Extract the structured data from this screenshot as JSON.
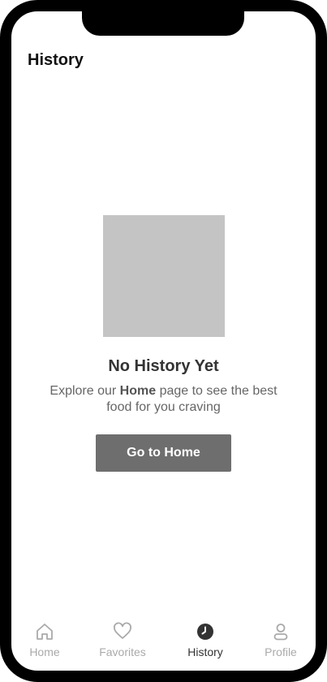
{
  "header": {
    "title": "History"
  },
  "empty_state": {
    "illustration": "image-placeholder",
    "title": "No History Yet",
    "desc_prefix": "Explore our ",
    "desc_link": "Home",
    "desc_suffix": " page to see the best food for you craving",
    "button_label": "Go to Home"
  },
  "tabbar": {
    "active": "History",
    "items": [
      {
        "label": "Home",
        "icon": "home-icon"
      },
      {
        "label": "Favorites",
        "icon": "heart-icon"
      },
      {
        "label": "History",
        "icon": "clock-icon"
      },
      {
        "label": "Profile",
        "icon": "user-icon"
      }
    ]
  },
  "colors": {
    "button_bg": "#6e6e6e",
    "placeholder": "#c4c4c4",
    "tab_active": "#333333",
    "tab_inactive": "#aaaaaa"
  }
}
